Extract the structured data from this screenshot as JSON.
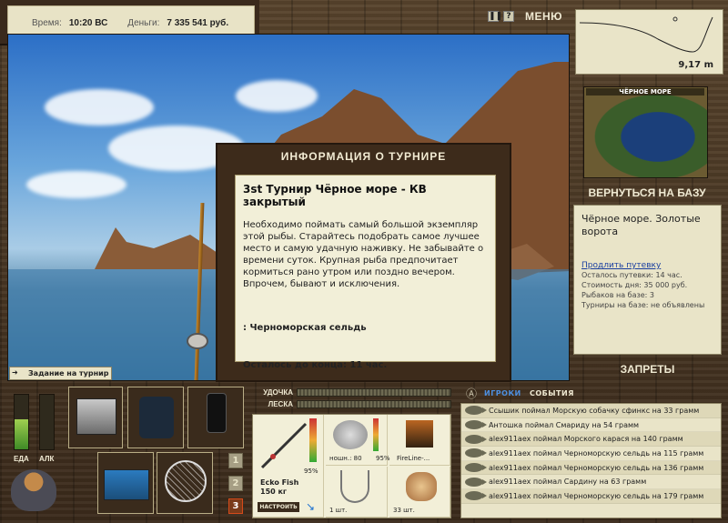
{
  "status": {
    "time_label": "Время:",
    "time_value": "10:20 ВС",
    "money_label": "Деньги:",
    "money_value": "7 335 541 руб."
  },
  "topbar": {
    "menu_label": "МЕНЮ",
    "pause_icon": "pause-icon",
    "help_icon": "help-icon"
  },
  "depth": {
    "value": "9,17 m"
  },
  "location": {
    "map_title": "ЧЁРНОЕ МОРЕ",
    "return_label": "ВЕРНУТЬСЯ НА БАЗУ",
    "name": "Чёрное море. Золотые ворота",
    "extend_link": "Продлить путевку",
    "lines": [
      "Осталось путевки: 14 час.",
      "Стоимость дня: 35 000 руб.",
      "Рыбаков на базе: 3",
      "Турниры на базе: не объявлены"
    ],
    "bans_label": "ЗАПРЕТЫ"
  },
  "dialog": {
    "title": "ИНФОРМАЦИЯ О ТУРНИРЕ",
    "heading": "3st Турнир Чёрное море - КВ закрытый",
    "description": "Необходимо поймать самый большой экземпляр этой рыбы. Старайтесь подобрать самое лучшее место и самую удачную наживку. Не забывайте о времени суток. Крупная рыба предпочитает кормиться рано утром или поздно вечером. Впрочем, бывают и исключения.",
    "fish": ": Черноморская сельдь",
    "remaining": "Осталось до конца: 11 час."
  },
  "task": {
    "label": "Задание на турнир"
  },
  "meters": {
    "food_label": "ЕДА",
    "alc_label": "АЛК",
    "food_level": 0.55,
    "alc_level": 0.0
  },
  "inventory": {
    "slot_buttons": [
      "1",
      "2",
      "3"
    ],
    "active_slot": "3"
  },
  "tackle": {
    "rod_label": "УДОЧКА",
    "line_label": "ЛЕСКА",
    "rod_name": "Ecko Fish",
    "rod_weight": "150 кг",
    "rod_wear": "95%",
    "reel_label": "ношн.: 80",
    "reel_wear": "95%",
    "line_name": "FireLine-...",
    "hook_count": "1 шт.",
    "bait_count": "33 шт.",
    "setup_label": "НАСТРОИТЬ"
  },
  "chat": {
    "tab_players": "ИГРОКИ",
    "tab_events": "СОБЫТИЯ",
    "messages": [
      "Ссышик поймал Морскую собачку сфинкс на 33 грамм",
      "Антошка поймал Смариду на 54 грамм",
      "alex911aex поймал Морского карася на 140 грамм",
      "alex911aex поймал Черноморскую сельдь на 115 грамм",
      "alex911aex поймал Черноморскую сельдь на 136 грамм",
      "alex911aex поймал Сардину на 63 грамм",
      "alex911aex поймал Черноморскую сельдь на 179 грамм"
    ]
  }
}
